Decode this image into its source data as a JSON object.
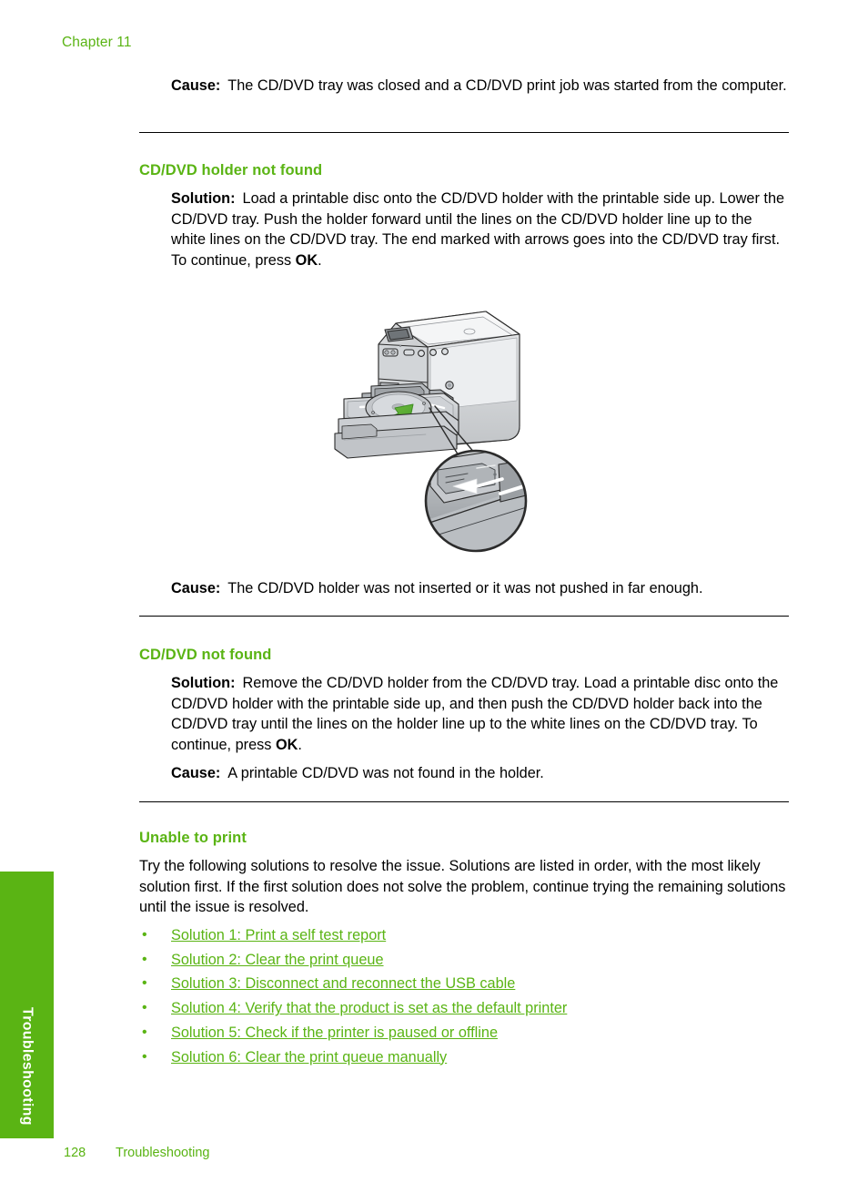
{
  "page": {
    "chapter": "Chapter 11",
    "side_tab_label": "Troubleshooting",
    "footer_page_number": "128",
    "footer_section": "Troubleshooting",
    "accent_green": "#5ab414",
    "text_color": "#000000"
  },
  "blocks": {
    "cause_top": {
      "lead": "Cause:",
      "text": "The CD/DVD tray was closed and a CD/DVD print job was started from the computer."
    },
    "section_holder_not_found": {
      "heading": "CD/DVD holder not found",
      "solution_lead": "Solution:",
      "solution_text_a": "Load a printable disc onto the CD/DVD holder with the printable side up. Lower the CD/DVD tray. Push the holder forward until the lines on the CD/DVD holder line up to the white lines on the CD/DVD tray. The end marked with arrows goes into the CD/DVD tray first. To continue, press ",
      "solution_bold": "OK",
      "solution_text_b": ".",
      "cause_lead": "Cause:",
      "cause_text": "The CD/DVD holder was not inserted or it was not pushed in far enough."
    },
    "section_cd_not_found": {
      "heading": "CD/DVD not found",
      "solution_lead": "Solution:",
      "solution_text_a": "Remove the CD/DVD holder from the CD/DVD tray. Load a printable disc onto the CD/DVD holder with the printable side up, and then push the CD/DVD holder back into the CD/DVD tray until the lines on the holder line up to the white lines on the CD/DVD tray. To continue, press ",
      "solution_bold": "OK",
      "solution_text_b": ".",
      "cause_lead": "Cause:",
      "cause_text": "A printable CD/DVD was not found in the holder."
    },
    "section_unable_to_print": {
      "heading": "Unable to print",
      "intro": "Try the following solutions to resolve the issue. Solutions are listed in order, with the most likely solution first. If the first solution does not solve the problem, continue trying the remaining solutions until the issue is resolved.",
      "bullet_char": "•",
      "links": [
        "Solution 1: Print a self test report",
        "Solution 2: Clear the print queue",
        "Solution 3: Disconnect and reconnect the USB cable",
        "Solution 4: Verify that the product is set as the default printer",
        "Solution 5: Check if the printer is paused or offline",
        "Solution 6: Clear the print queue manually"
      ]
    }
  },
  "figure": {
    "alt": "All-in-one printer with CD/DVD tray lowered and CD/DVD holder being pushed in, with a magnified detail circle showing the alignment arrow on the tray",
    "callout_detail": "magnified-alignment-arrow"
  }
}
